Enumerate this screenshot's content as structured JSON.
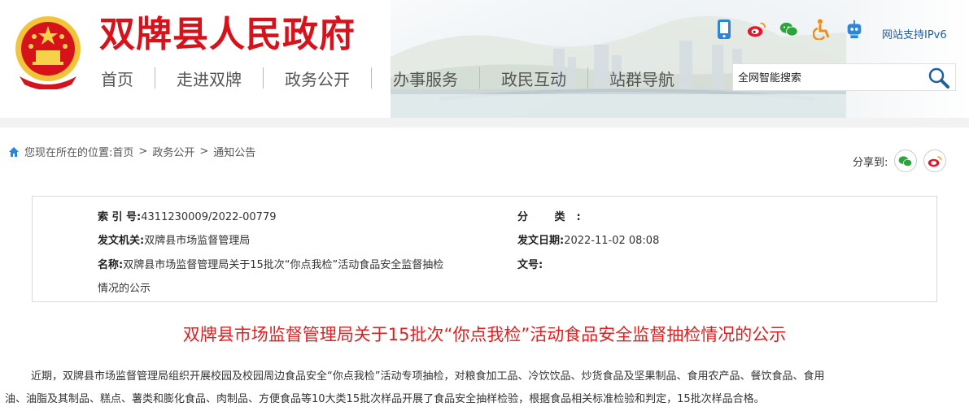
{
  "header": {
    "site_title": "双牌县人民政府",
    "ipv6_label": "网站支持IPv6",
    "nav": [
      "首页",
      "走进双牌",
      "政务公开",
      "办事服务",
      "政民互动",
      "站群导航"
    ],
    "search_placeholder": "全网智能搜索",
    "icons": [
      "mobile-icon",
      "weibo-icon",
      "wechat-icon",
      "accessibility-icon",
      "robot-icon"
    ]
  },
  "breadcrumb": {
    "prefix": "您现在所在的位置:",
    "items": [
      "首页",
      "政务公开",
      "通知公告"
    ],
    "separator": ">"
  },
  "share": {
    "label": "分享到:"
  },
  "meta": {
    "index_label": "索 引 号:",
    "index_value": "4311230009/2022-00779",
    "category_label": "分 类:",
    "category_value": "",
    "issuer_label": "发文机关:",
    "issuer_value": "双牌县市场监督管理局",
    "date_label": "发文日期:",
    "date_value": "2022-11-02 08:08",
    "name_label": "名称:",
    "name_value_line1": "双牌县市场监督管理局关于15批次“你点我检”活动食品安全监督抽检",
    "name_value_line2": "情况的公示",
    "docno_label": "文号:",
    "docno_value": ""
  },
  "article": {
    "title": "双牌县市场监督管理局关于15批次“你点我检”活动食品安全监督抽检情况的公示",
    "paragraph_line1": "近期，双牌县市场监督管理局组织开展校园及校园周边食品安全“你点我检”活动专项抽检，对粮食加工品、冷饮饮品、炒货食品及坚果制品、食用农产品、餐饮食品、食用",
    "paragraph_line2": "油、油脂及其制品、糕点、薯类和膨化食品、肉制品、方便食品等10大类15批次样品开展了食品安全抽样检验，根据食品相关标准检验和判定，15批次样品合格。"
  },
  "colors": {
    "brand_red": "#d8121a",
    "title_red": "#e02020",
    "link_blue": "#1a5fa8"
  }
}
